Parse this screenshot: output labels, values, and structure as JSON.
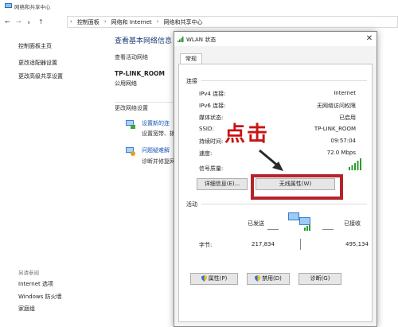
{
  "window": {
    "title": "网络和共享中心",
    "breadcrumb": [
      "控制面板",
      "网络和 Internet",
      "网络和共享中心"
    ]
  },
  "sidebar": {
    "items": [
      "控制面板主页",
      "更改适配器设置",
      "更改高级共享设置"
    ],
    "see_also_label": "另请参阅",
    "see_also": [
      "Internet 选项",
      "Windows 防火墙",
      "家庭组"
    ]
  },
  "main": {
    "heading": "查看基本网络信息",
    "active_networks_label": "查看活动网络",
    "network_name": "TP-LINK_ROOM",
    "network_type": "公用网络",
    "change_settings_label": "更改网络设置",
    "setup_link": "设置新的连",
    "setup_desc": "设置宽带、拨",
    "troubleshoot_link": "问题疑难解",
    "troubleshoot_desc": "诊断并修复网"
  },
  "dialog": {
    "title": "WLAN 状态",
    "close_glyph": "✕",
    "tab": "常规",
    "connection_group": "连接",
    "rows": [
      {
        "key": "IPv4 连接:",
        "value": "Internet"
      },
      {
        "key": "IPv6 连接:",
        "value": "无网络访问权限"
      },
      {
        "key": "媒体状态:",
        "value": "已启用"
      },
      {
        "key": "SSID:",
        "value": "TP-LINK_ROOM"
      },
      {
        "key": "持续时间:",
        "value": "09:57:04"
      },
      {
        "key": "速度:",
        "value": "72.0 Mbps"
      }
    ],
    "signal_label": "信号质量:",
    "signal_bars": 5,
    "details_button": "详细信息(E)...",
    "wireless_props_button": "无线属性(W)",
    "activity_group": "活动",
    "sent_label": "已发送",
    "received_label": "已接收",
    "bytes_label": "字节:",
    "bytes_sent": "217,834",
    "bytes_received": "495,134",
    "properties_button": "属性(P)",
    "disable_button": "禁用(D)",
    "diagnose_button": "诊断(G)"
  },
  "annotation": {
    "text": "点击",
    "color": "#c81414"
  }
}
